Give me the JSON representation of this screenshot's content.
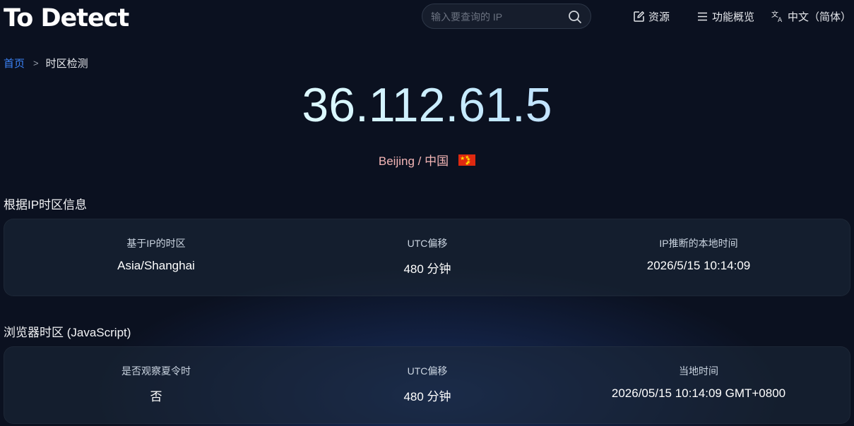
{
  "header": {
    "logo_prefix": "To",
    "logo_suffix": "Detect",
    "search_placeholder": "输入要查询的 IP",
    "nav": {
      "resources": "资源",
      "features": "功能概览",
      "language": "中文（简体）"
    },
    "icons": [
      "edit-icon",
      "menu-icon",
      "translate-icon",
      "search-icon"
    ]
  },
  "breadcrumb": {
    "home": "首页",
    "separator": ">",
    "current": "时区检测"
  },
  "ip": {
    "address": "36.112.61.5",
    "location": "Beijing / 中国",
    "flag": "china-flag"
  },
  "ip_timezone": {
    "title": "根据IP时区信息",
    "columns": [
      {
        "label": "基于IP的时区",
        "value": "Asia/Shanghai"
      },
      {
        "label": "UTC偏移",
        "value": "480 分钟"
      },
      {
        "label": "IP推断的本地时间",
        "value": "2026/5/15 10:14:09"
      }
    ]
  },
  "browser_timezone": {
    "title": "浏览器时区 (JavaScript)",
    "columns": [
      {
        "label": "是否观察夏令时",
        "value": "否"
      },
      {
        "label": "UTC偏移",
        "value": "480 分钟"
      },
      {
        "label": "当地时间",
        "value": "2026/05/15 10:14:09 GMT+0800"
      }
    ]
  },
  "colors": {
    "background": "#0b1120",
    "accent": "#3b82f6",
    "location_text": "#f4b6b6",
    "card": "#1e293b"
  }
}
